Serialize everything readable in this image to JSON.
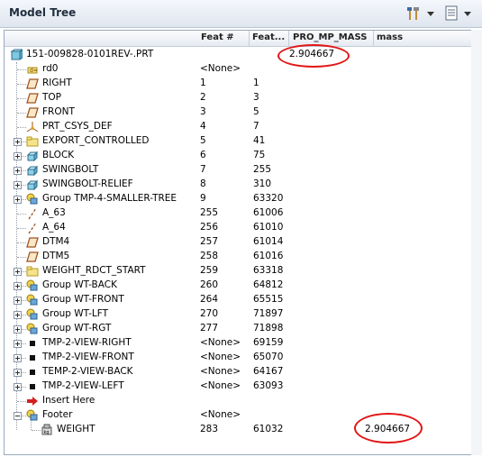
{
  "panel": {
    "title": "Model Tree",
    "toolbar": [
      {
        "name": "tree-settings-icon"
      },
      {
        "name": "tree-columns-icon"
      }
    ]
  },
  "columns": [
    "Feat #",
    "Feat...",
    "PRO_MP_MASS",
    "mass"
  ],
  "colors": {
    "annotation": "#e31515",
    "expander_border": "#8a97a8"
  },
  "rows": [
    {
      "label": "151-009828-0101REV-.PRT",
      "feat_num": "",
      "feat_id": "",
      "pro_mp_mass": "2.904667",
      "mass": "",
      "icon": "part-icon",
      "expander": ""
    },
    {
      "label": "rd0",
      "feat_num": "<None>",
      "feat_id": "",
      "pro_mp_mass": "",
      "mass": "",
      "icon": "relation-icon",
      "expander": ""
    },
    {
      "label": "RIGHT",
      "feat_num": "1",
      "feat_id": "1",
      "pro_mp_mass": "",
      "mass": "",
      "icon": "datum-plane-icon",
      "expander": ""
    },
    {
      "label": "TOP",
      "feat_num": "2",
      "feat_id": "3",
      "pro_mp_mass": "",
      "mass": "",
      "icon": "datum-plane-icon",
      "expander": ""
    },
    {
      "label": "FRONT",
      "feat_num": "3",
      "feat_id": "5",
      "pro_mp_mass": "",
      "mass": "",
      "icon": "datum-plane-icon",
      "expander": ""
    },
    {
      "label": "PRT_CSYS_DEF",
      "feat_num": "4",
      "feat_id": "7",
      "pro_mp_mass": "",
      "mass": "",
      "icon": "csys-icon",
      "expander": ""
    },
    {
      "label": "EXPORT_CONTROLLED",
      "feat_num": "5",
      "feat_id": "41",
      "pro_mp_mass": "",
      "mass": "",
      "icon": "layer-folder-icon",
      "expander": "plus"
    },
    {
      "label": "BLOCK",
      "feat_num": "6",
      "feat_id": "75",
      "pro_mp_mass": "",
      "mass": "",
      "icon": "extrude-icon",
      "expander": "plus"
    },
    {
      "label": "SWINGBOLT",
      "feat_num": "7",
      "feat_id": "255",
      "pro_mp_mass": "",
      "mass": "",
      "icon": "extrude-icon",
      "expander": "plus"
    },
    {
      "label": "SWINGBOLT-RELIEF",
      "feat_num": "8",
      "feat_id": "310",
      "pro_mp_mass": "",
      "mass": "",
      "icon": "extrude-icon",
      "expander": "plus"
    },
    {
      "label": "Group TMP-4-SMALLER-TREE",
      "feat_num": "9",
      "feat_id": "63320",
      "pro_mp_mass": "",
      "mass": "",
      "icon": "group-icon",
      "expander": "plus"
    },
    {
      "label": "A_63",
      "feat_num": "255",
      "feat_id": "61006",
      "pro_mp_mass": "",
      "mass": "",
      "icon": "datum-axis-icon",
      "expander": ""
    },
    {
      "label": "A_64",
      "feat_num": "256",
      "feat_id": "61010",
      "pro_mp_mass": "",
      "mass": "",
      "icon": "datum-axis-icon",
      "expander": ""
    },
    {
      "label": "DTM4",
      "feat_num": "257",
      "feat_id": "61014",
      "pro_mp_mass": "",
      "mass": "",
      "icon": "datum-plane-icon",
      "expander": ""
    },
    {
      "label": "DTM5",
      "feat_num": "258",
      "feat_id": "61016",
      "pro_mp_mass": "",
      "mass": "",
      "icon": "datum-plane-icon",
      "expander": ""
    },
    {
      "label": "WEIGHT_RDCT_START",
      "feat_num": "259",
      "feat_id": "63318",
      "pro_mp_mass": "",
      "mass": "",
      "icon": "layer-folder-icon",
      "expander": "plus"
    },
    {
      "label": "Group WT-BACK",
      "feat_num": "260",
      "feat_id": "64812",
      "pro_mp_mass": "",
      "mass": "",
      "icon": "group-icon",
      "expander": "plus"
    },
    {
      "label": "Group WT-FRONT",
      "feat_num": "264",
      "feat_id": "65515",
      "pro_mp_mass": "",
      "mass": "",
      "icon": "group-icon",
      "expander": "plus"
    },
    {
      "label": "Group WT-LFT",
      "feat_num": "270",
      "feat_id": "71897",
      "pro_mp_mass": "",
      "mass": "",
      "icon": "group-icon",
      "expander": "plus"
    },
    {
      "label": "Group WT-RGT",
      "feat_num": "277",
      "feat_id": "71898",
      "pro_mp_mass": "",
      "mass": "",
      "icon": "group-icon",
      "expander": "plus"
    },
    {
      "label": "TMP-2-VIEW-RIGHT",
      "feat_num": "<None>",
      "feat_id": "69159",
      "pro_mp_mass": "",
      "mass": "",
      "icon": "view-icon",
      "expander": "plus"
    },
    {
      "label": "TMP-2-VIEW-FRONT",
      "feat_num": "<None>",
      "feat_id": "65070",
      "pro_mp_mass": "",
      "mass": "",
      "icon": "view-icon",
      "expander": "plus"
    },
    {
      "label": "TEMP-2-VIEW-BACK",
      "feat_num": "<None>",
      "feat_id": "64167",
      "pro_mp_mass": "",
      "mass": "",
      "icon": "view-icon",
      "expander": "plus"
    },
    {
      "label": "TMP-2-VIEW-LEFT",
      "feat_num": "<None>",
      "feat_id": "63093",
      "pro_mp_mass": "",
      "mass": "",
      "icon": "view-icon",
      "expander": "plus"
    },
    {
      "label": "Insert Here",
      "feat_num": "",
      "feat_id": "",
      "pro_mp_mass": "",
      "mass": "",
      "icon": "insert-arrow-icon",
      "expander": ""
    },
    {
      "label": "Footer",
      "feat_num": "<None>",
      "feat_id": "",
      "pro_mp_mass": "",
      "mass": "",
      "icon": "group-icon",
      "expander": "minus"
    },
    {
      "label": "WEIGHT",
      "feat_num": "283",
      "feat_id": "61032",
      "pro_mp_mass": "",
      "mass": "2.904667",
      "icon": "analysis-feature-icon",
      "expander": ""
    }
  ]
}
